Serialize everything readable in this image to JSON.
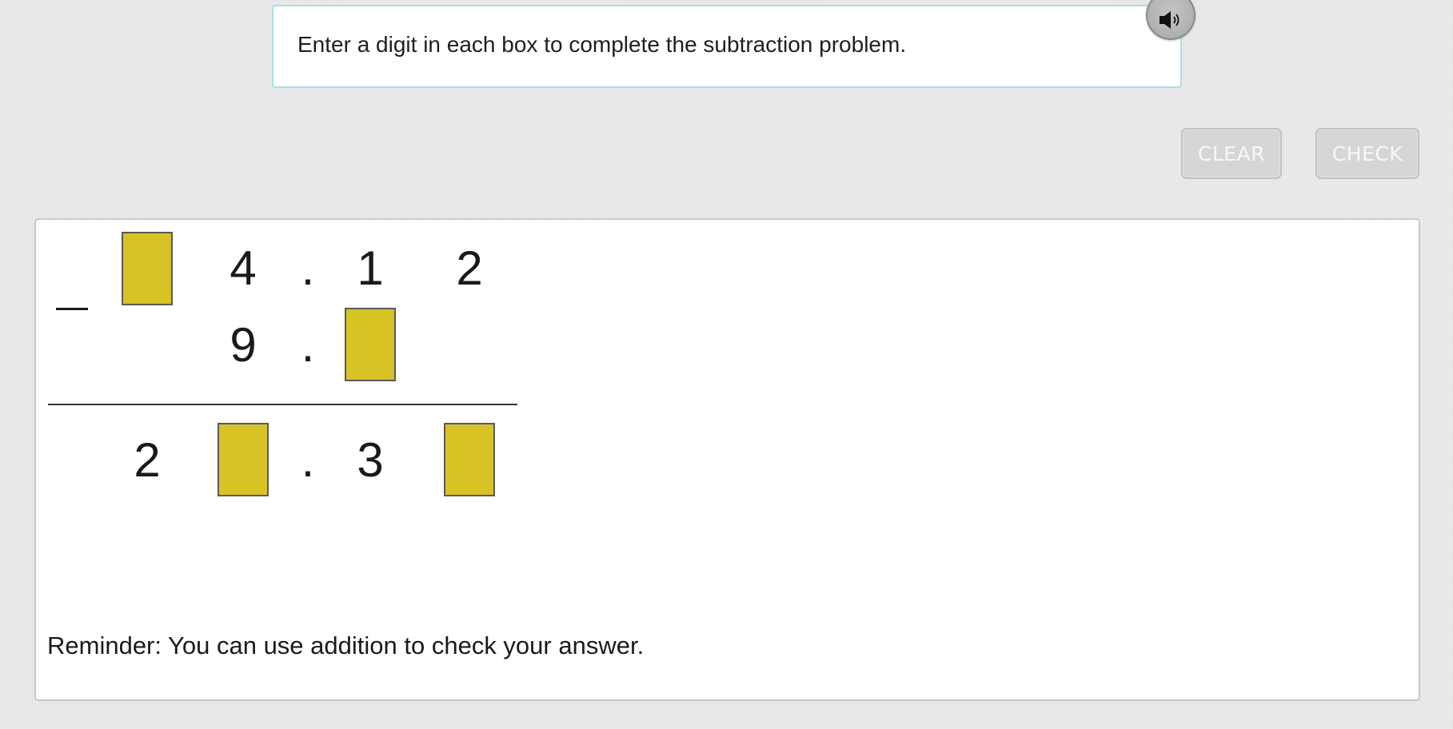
{
  "prompt": {
    "text": "Enter a digit in each box to complete the subtraction problem."
  },
  "audio": {
    "icon": "speaker-icon"
  },
  "toolbar": {
    "clear_label": "CLEAR",
    "check_label": "CHECK"
  },
  "problem": {
    "operator": "–",
    "decimal_point": ".",
    "minuend": {
      "ones": "4",
      "tenths": "1",
      "hundredths": "2"
    },
    "subtrahend": {
      "ones": "9"
    },
    "difference": {
      "tens": "2",
      "tenths": "3"
    },
    "box_color": "#d8c326"
  },
  "reminder": {
    "text": "Reminder: You can use addition to check your answer."
  }
}
